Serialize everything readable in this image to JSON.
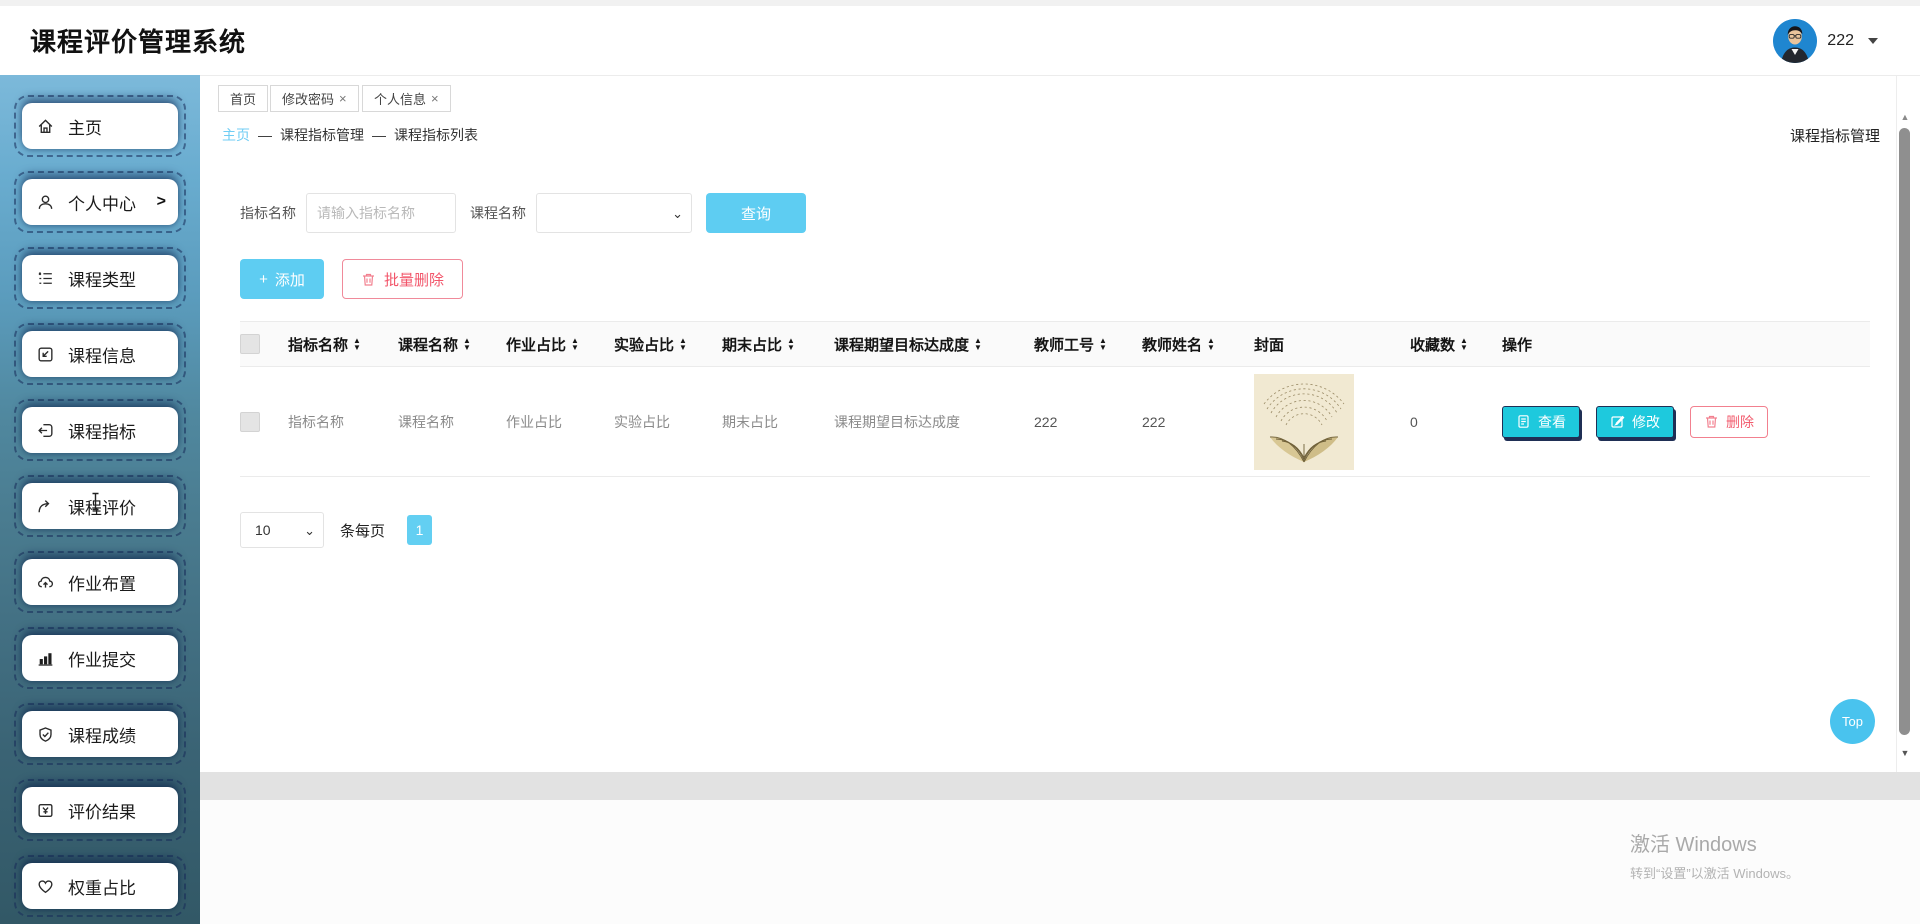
{
  "colors": {
    "accent": "#5ecdf2",
    "action_cyan": "#1ec9dd",
    "danger": "#f25c6e",
    "link_blue": "#70cdf4",
    "sidebar_top": "#7cb9da",
    "sidebar_bottom": "#325866"
  },
  "header": {
    "title": "课程评价管理系统",
    "username": "222"
  },
  "sidebar": {
    "items": [
      {
        "label": "主页"
      },
      {
        "label": "个人中心"
      },
      {
        "label": "课程类型"
      },
      {
        "label": "课程信息"
      },
      {
        "label": "课程指标"
      },
      {
        "label": "课程评价"
      },
      {
        "label": "作业布置"
      },
      {
        "label": "作业提交"
      },
      {
        "label": "课程成绩"
      },
      {
        "label": "评价结果"
      },
      {
        "label": "权重占比"
      }
    ]
  },
  "tabs": [
    {
      "label": "首页",
      "closable": false
    },
    {
      "label": "修改密码",
      "closable": true
    },
    {
      "label": "个人信息",
      "closable": true
    }
  ],
  "breadcrumb": {
    "separator": "—",
    "items": [
      "主页",
      "课程指标管理",
      "课程指标列表"
    ],
    "page_title": "课程指标管理"
  },
  "search": {
    "name_label": "指标名称",
    "name_placeholder": "请输入指标名称",
    "name_value": "",
    "course_label": "课程名称",
    "course_selected": "",
    "query_label": "查询"
  },
  "toolbar": {
    "add_label": "添加",
    "batch_delete_label": "批量删除"
  },
  "table": {
    "columns": [
      {
        "label": "指标名称",
        "sortable": true
      },
      {
        "label": "课程名称",
        "sortable": true
      },
      {
        "label": "作业占比",
        "sortable": true
      },
      {
        "label": "实验占比",
        "sortable": true
      },
      {
        "label": "期末占比",
        "sortable": true
      },
      {
        "label": "课程期望目标达成度",
        "sortable": true
      },
      {
        "label": "教师工号",
        "sortable": true
      },
      {
        "label": "教师姓名",
        "sortable": true
      },
      {
        "label": "封面",
        "sortable": false
      },
      {
        "label": "收藏数",
        "sortable": true
      },
      {
        "label": "操作",
        "sortable": false
      }
    ],
    "row": {
      "indicator_name": "指标名称",
      "course_name": "课程名称",
      "homework_ratio": "作业占比",
      "experiment_ratio": "实验占比",
      "final_ratio": "期末占比",
      "expected_achievement": "课程期望目标达成度",
      "teacher_id": "222",
      "teacher_name": "222",
      "favorites": "0"
    },
    "actions": {
      "view": "查看",
      "edit": "修改",
      "delete": "删除"
    }
  },
  "pagination": {
    "page_size": "10",
    "per_page_label": "条每页",
    "current_page": "1"
  },
  "scroll": {
    "top_label": "Top"
  },
  "watermark": {
    "line1": "激活 Windows",
    "line2": "转到“设置”以激活 Windows。"
  },
  "icons": {
    "sort_up": "▲",
    "sort_down": "▼",
    "close": "×",
    "plus": "+",
    "chevron_right": ">",
    "select_chevron": "⌄",
    "scroll_up": "▲",
    "scroll_down": "▼"
  }
}
